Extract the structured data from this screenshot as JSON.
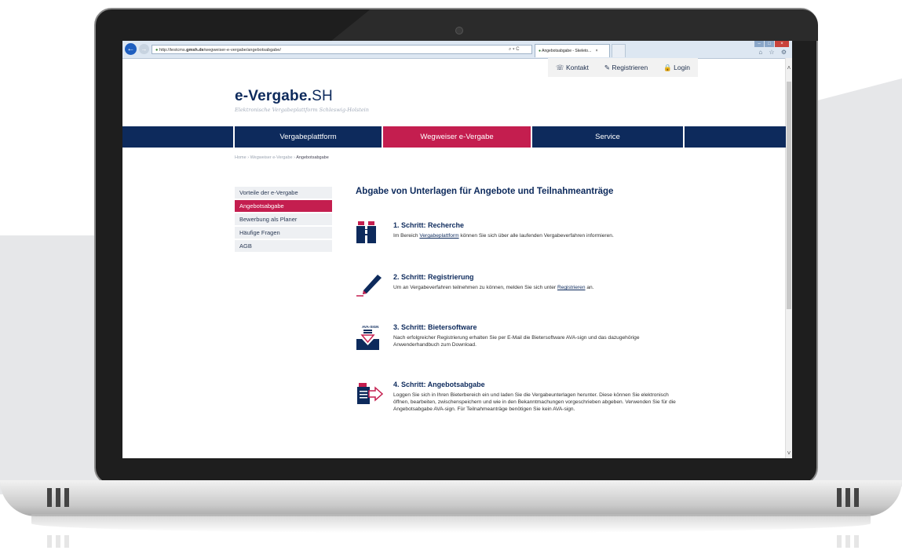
{
  "browser": {
    "url_prefix": "http://testcms.",
    "url_domain": "gmsh.de",
    "url_path": "/wegweiser-e-vergabe/angebotsabgabe/",
    "address_controls": "⌕ ▾ C",
    "tab_title": "Angebotsabgabe - Skeleto...",
    "tab_close": "×",
    "window_minimize": "–",
    "window_maximize": "□",
    "window_close": "×",
    "tools": "⌂ ☆ ⚙"
  },
  "utility_nav": {
    "contact": "Kontakt",
    "register": "Registrieren",
    "login": "Login"
  },
  "logo": {
    "main": "e-Vergabe.",
    "suffix": "SH",
    "subtitle": "Elektronische Vergabeplattform Schleswig-Holstein"
  },
  "main_nav": [
    {
      "label": "Vergabeplattform"
    },
    {
      "label": "Wegweiser e-Vergabe"
    },
    {
      "label": "Service"
    }
  ],
  "breadcrumb": {
    "items": [
      "Home",
      "Wegweiser e-Vergabe"
    ],
    "current": "Angebotsabgabe",
    "separator": "›"
  },
  "sidebar": [
    {
      "label": "Vorteile der e-Vergabe"
    },
    {
      "label": "Angebotsabgabe"
    },
    {
      "label": "Bewerbung als Planer"
    },
    {
      "label": "Häufige Fragen"
    },
    {
      "label": "AGB"
    }
  ],
  "content": {
    "title": "Abgabe von Unterlagen für Angebote und Teilnahmeanträge",
    "steps": [
      {
        "title": "1. Schritt: Recherche",
        "text_before": "Im Bereich ",
        "link": "Vergabeplattform",
        "text_after": " können Sie sich über alle laufenden Vergabeverfahren informieren."
      },
      {
        "title": "2. Schritt: Registrierung",
        "text_before": "Um an Vergabeverfahren teilnehmen zu können, melden Sie sich unter ",
        "link": "Registrieren",
        "text_after": " an."
      },
      {
        "title": "3. Schritt: Bietersoftware",
        "icon_label": "AVA-SIGN",
        "text": "Nach erfolgreicher Registrierung erhalten Sie per E-Mail die Bietersoftware AVA-sign und das dazugehörige Anwenderhandbuch zum Download."
      },
      {
        "title": "4. Schritt: Angebotsabgabe",
        "text": "Loggen Sie sich in Ihren Bieterbereich ein und laden Sie die Vergabeunterlagen herunter. Diese können Sie elektronisch öffnen, bearbeiten, zwischenspeichern und wie in den Bekanntmachungen vorgeschrieben abgeben. Verwenden Sie für die Angebotsabgabe AVA-sign. Für Teilnahmeanträge benötigen Sie kein AVA-sign."
      }
    ]
  },
  "colors": {
    "navy": "#0d2a5c",
    "crimson": "#c41e4f",
    "sidebar_bg": "#eef0f3"
  }
}
